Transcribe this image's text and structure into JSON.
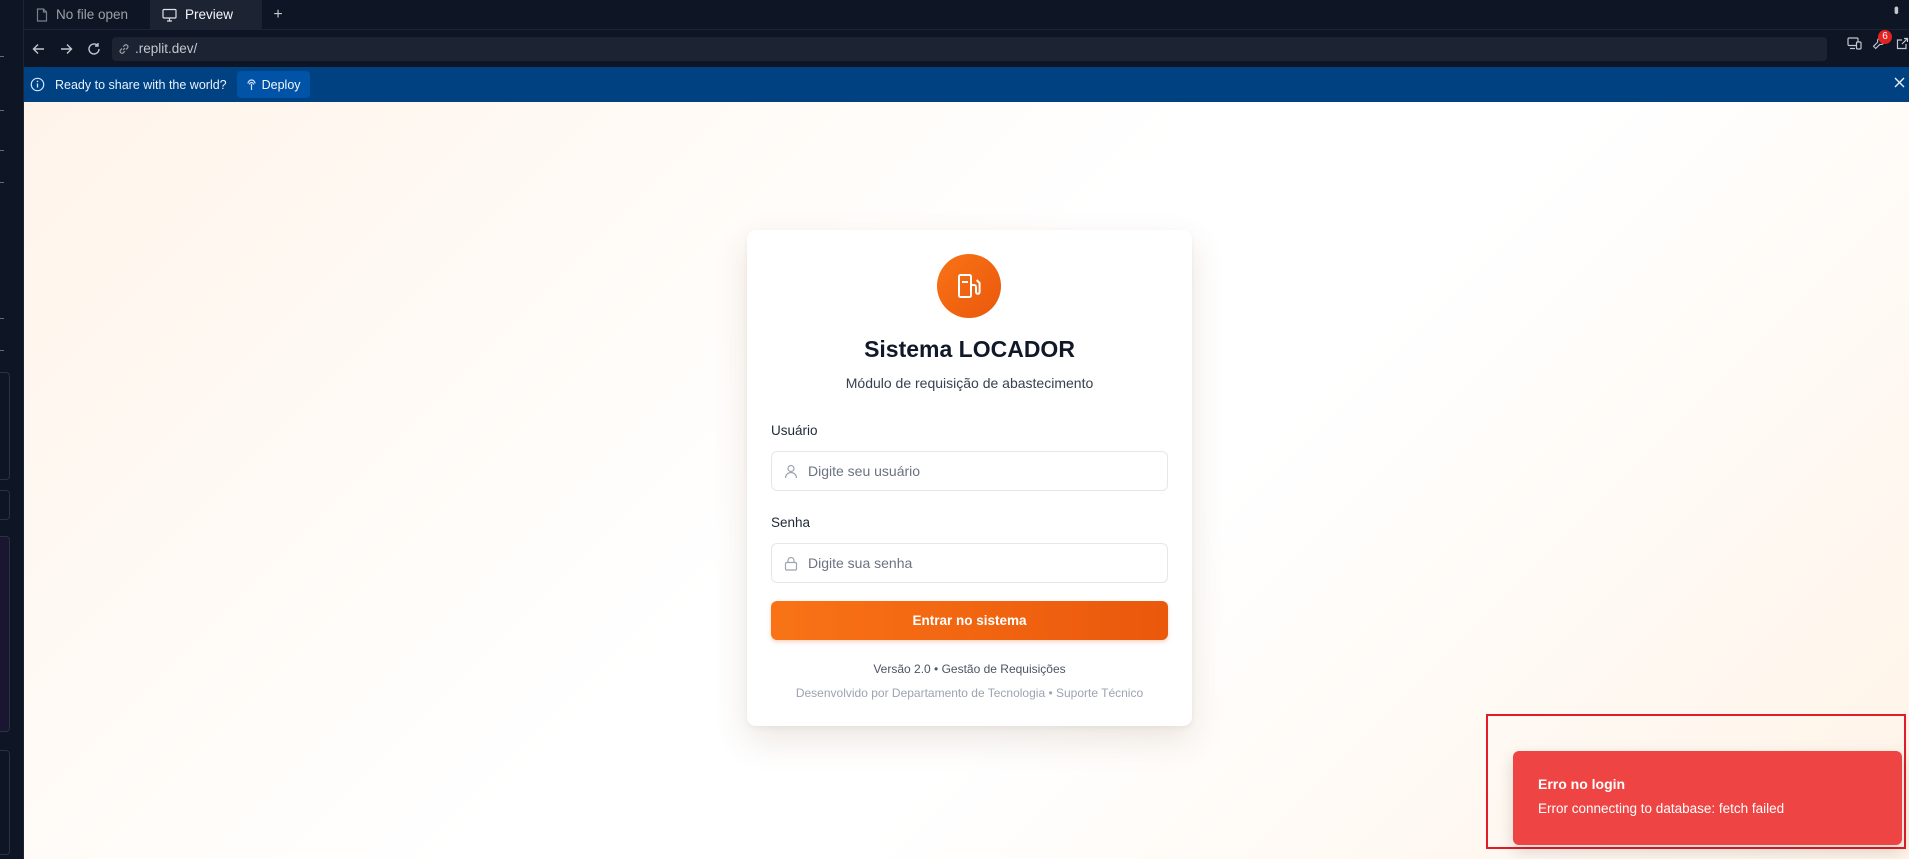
{
  "tabs": [
    {
      "label": "No file open",
      "active": false,
      "icon": "file-icon"
    },
    {
      "label": "Preview",
      "active": true,
      "icon": "monitor-icon"
    }
  ],
  "address_bar": {
    "url": ".replit.dev/",
    "notification_count": "6"
  },
  "banner": {
    "message": "Ready to share with the world?",
    "deploy_label": "Deploy",
    "color": "#004182"
  },
  "login": {
    "title": "Sistema LOCADOR",
    "subtitle": "Módulo de requisição de abastecimento",
    "username_label": "Usuário",
    "username_placeholder": "Digite seu usuário",
    "password_label": "Senha",
    "password_placeholder": "Digite sua senha",
    "submit_label": "Entrar no sistema",
    "version_line": "Versão 2.0 • Gestão de Requisições",
    "credits_line": "Desenvolvido por Departamento de Tecnologia • Suporte Técnico",
    "logo_icon": "fuel-pump-icon",
    "accent_color": "#f97316"
  },
  "toast": {
    "title": "Erro no login",
    "description": "Error connecting to database: fetch failed",
    "color": "#ef4444"
  }
}
